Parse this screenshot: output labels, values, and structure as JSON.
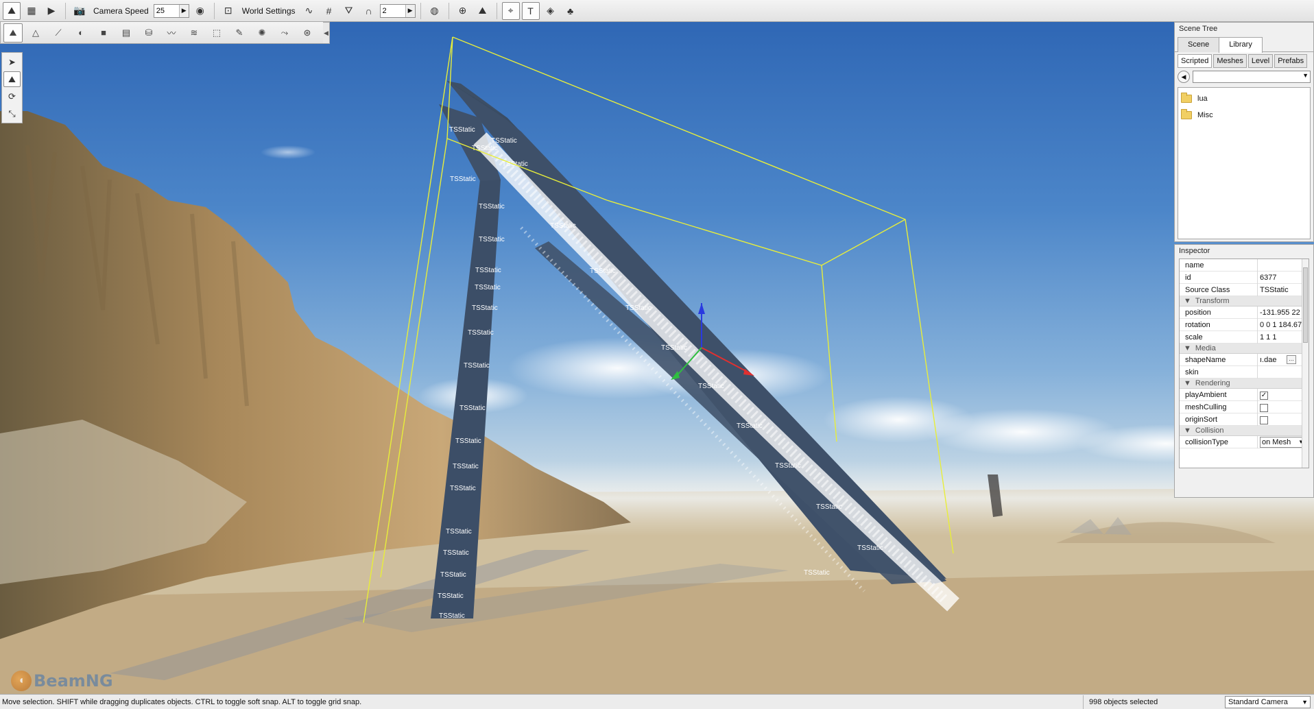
{
  "toolbar": {
    "camera_speed_label": "Camera Speed",
    "camera_speed_value": "25",
    "world_settings_label": "World Settings",
    "snap_value": "2"
  },
  "viewport": {
    "object_label": "TSStatic",
    "watermark": "BeamNG",
    "colors": {
      "selection_box": "#e8ee3a",
      "mesh": "#3d4f66",
      "gizmo_x": "#e03030",
      "gizmo_y": "#2fbf3f",
      "gizmo_z": "#2a3ae0"
    }
  },
  "scene_tree": {
    "title": "Scene Tree",
    "tabs": [
      "Scene",
      "Library"
    ],
    "active_tab": "Library",
    "subtabs": [
      "Scripted",
      "Meshes",
      "Level",
      "Prefabs"
    ],
    "active_subtab": "Scripted",
    "path_value": "",
    "items": [
      "lua",
      "Misc"
    ]
  },
  "inspector": {
    "title": "Inspector",
    "fields": {
      "name": {
        "label": "name",
        "value": ""
      },
      "id": {
        "label": "id",
        "value": "6377"
      },
      "source_class": {
        "label": "Source Class",
        "value": "TSStatic"
      }
    },
    "groups": {
      "transform": "Transform",
      "media": "Media",
      "rendering": "Rendering",
      "collision": "Collision"
    },
    "transform": {
      "position": {
        "label": "position",
        "value": "-131.955 22"
      },
      "rotation": {
        "label": "rotation",
        "value": "0 0 1 184.67"
      },
      "scale": {
        "label": "scale",
        "value": "1 1 1"
      }
    },
    "media": {
      "shape_name": {
        "label": "shapeName",
        "value": "ı.dae"
      },
      "skin": {
        "label": "skin",
        "value": ""
      }
    },
    "rendering": {
      "play_ambient": {
        "label": "playAmbient",
        "checked": true
      },
      "mesh_culling": {
        "label": "meshCulling",
        "checked": false
      },
      "origin_sort": {
        "label": "originSort",
        "checked": false
      }
    },
    "collision": {
      "collision_type": {
        "label": "collisionType",
        "value": "on Mesh"
      }
    }
  },
  "status_bar": {
    "message": "Move selection.  SHIFT while dragging duplicates objects.  CTRL to toggle soft snap.  ALT to toggle grid snap.",
    "selection_count": "998 objects selected",
    "camera_mode": "Standard Camera"
  },
  "icons": {
    "top_toolbar": [
      "world-editor-icon",
      "gui-editor-icon",
      "play-icon",
      "camera-icon",
      "visibility-icon",
      "fit-view-icon",
      "snap-rotate-icon",
      "grid-snap-icon",
      "terrain-snap-icon",
      "magnet-icon",
      "bounds-icon",
      "object-center-icon",
      "object-box-icon",
      "selection-icon",
      "text-label-icon",
      "render-obj-icon",
      "forest-icon"
    ],
    "sub_toolbar": [
      "object-editor-icon",
      "terrain-editor-icon",
      "terrain-painter-icon",
      "material-icon",
      "sketch-icon",
      "decal-icon",
      "road-icon",
      "river-icon",
      "mesh-road-icon",
      "mission-area-icon",
      "forest-brush-icon",
      "particle-icon",
      "decal-road-icon",
      "navmesh-icon"
    ],
    "gizmo": [
      "select-arrow-icon",
      "move-gizmo-icon",
      "rotate-gizmo-icon",
      "scale-gizmo-icon"
    ]
  }
}
